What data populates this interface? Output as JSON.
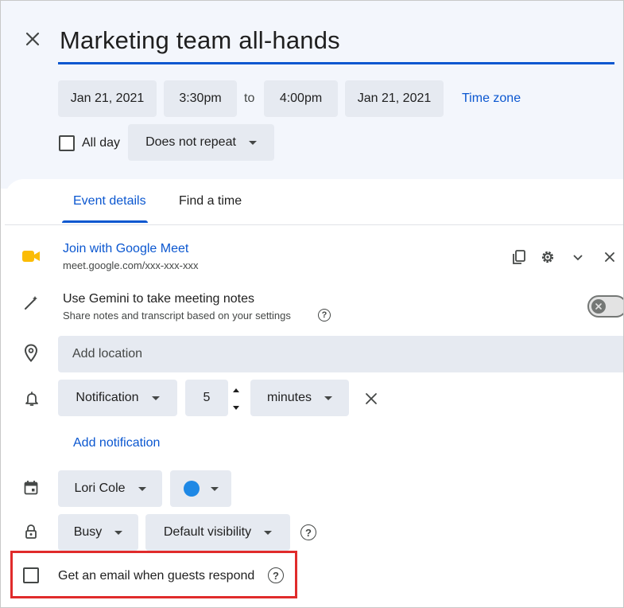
{
  "event": {
    "title": "Marketing team all-hands",
    "start_date": "Jan 21, 2021",
    "start_time": "3:30pm",
    "to_label": "to",
    "end_time": "4:00pm",
    "end_date": "Jan 21, 2021",
    "time_zone_link": "Time zone",
    "all_day_label": "All day",
    "repeat_value": "Does not repeat"
  },
  "tabs": [
    {
      "label": "Event details",
      "active": true
    },
    {
      "label": "Find a time",
      "active": false
    }
  ],
  "meet": {
    "title": "Join with Google Meet",
    "url": "meet.google.com/xxx-xxx-xxx"
  },
  "gemini": {
    "title": "Use Gemini to take meeting notes",
    "subtitle": "Share notes and transcript based on your settings",
    "enabled": false
  },
  "location": {
    "placeholder": "Add location"
  },
  "notification": {
    "type": "Notification",
    "amount": "5",
    "unit": "minutes",
    "add_label": "Add notification"
  },
  "calendar": {
    "owner": "Lori Cole",
    "color": "#1e88e5"
  },
  "availability": {
    "status": "Busy",
    "visibility": "Default visibility"
  },
  "guest_email": {
    "label": "Get an email when guests respond",
    "checked": false
  },
  "colors": {
    "accent": "#0b57d0",
    "chip_bg": "#e6eaf1",
    "header_bg": "#f3f6fc",
    "highlight": "#e02b2b",
    "meet_icon": "#fbbc04"
  }
}
